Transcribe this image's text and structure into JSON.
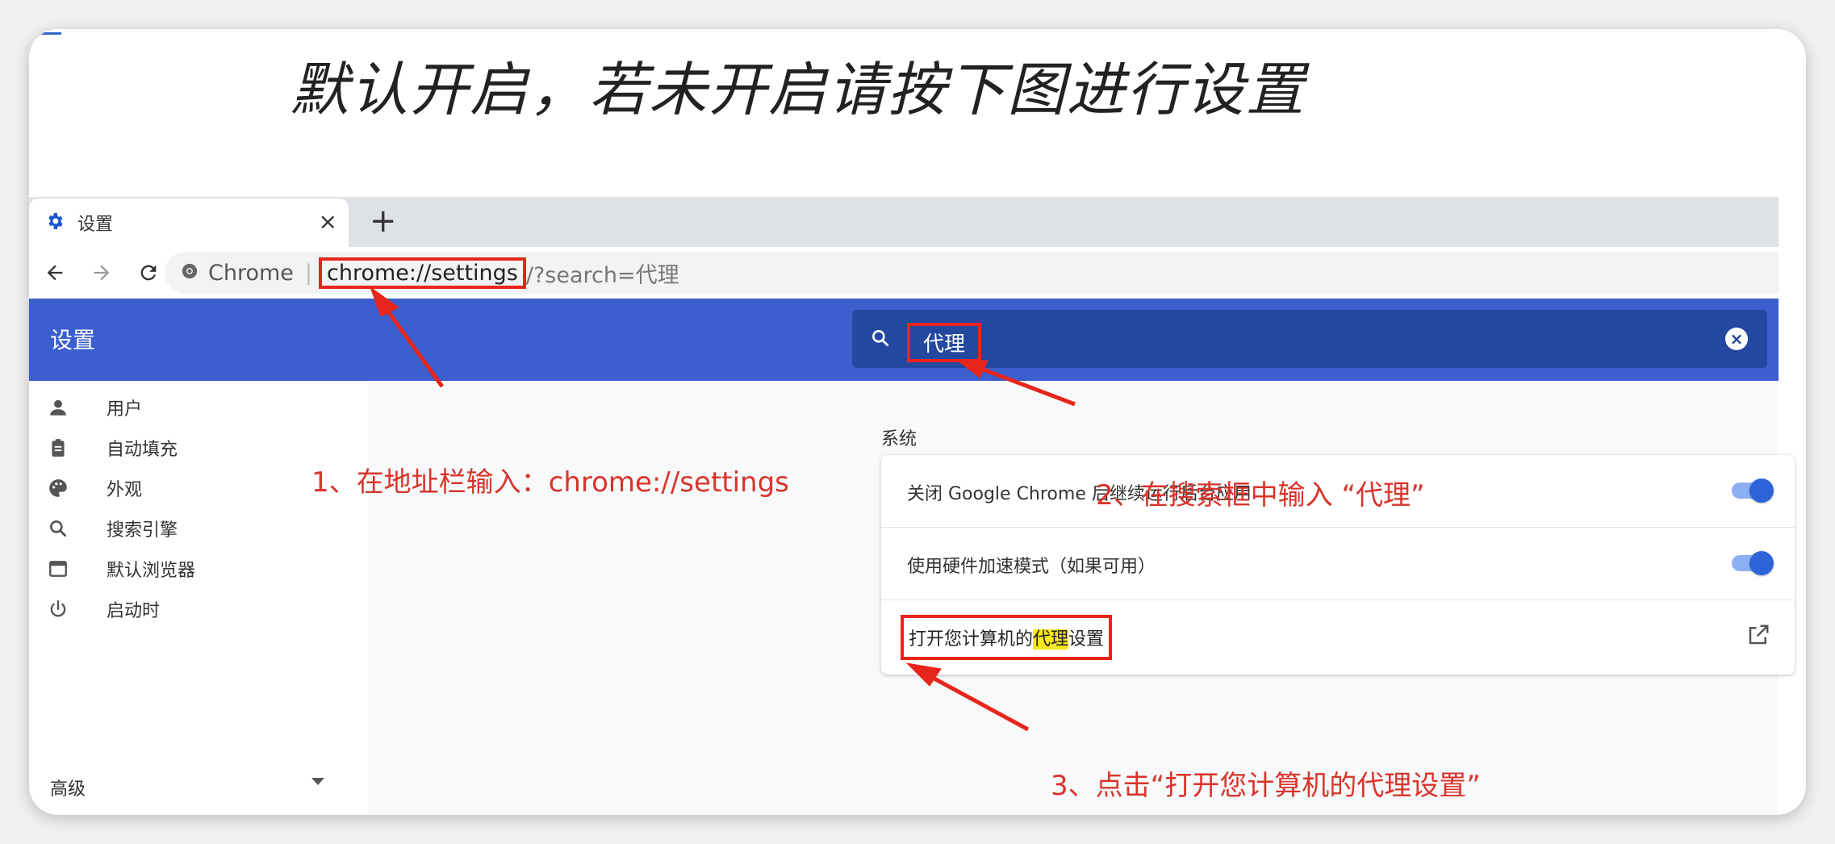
{
  "headline": "默认开启，若未开启请按下图进行设置",
  "tab": {
    "title": "设置",
    "close": "×",
    "new_tab": "+"
  },
  "toolbar": {
    "chip": "Chrome",
    "separator": "|",
    "url": "chrome://settings",
    "query": "/?search=代理"
  },
  "settings": {
    "title": "设置",
    "search": {
      "value": "代理"
    }
  },
  "sidebar": {
    "items": [
      {
        "label": "用户",
        "icon": "person-icon"
      },
      {
        "label": "自动填充",
        "icon": "clipboard-icon"
      },
      {
        "label": "外观",
        "icon": "palette-icon"
      },
      {
        "label": "搜索引擎",
        "icon": "search-icon"
      },
      {
        "label": "默认浏览器",
        "icon": "browser-window-icon"
      },
      {
        "label": "启动时",
        "icon": "power-icon"
      }
    ],
    "advanced": "高级"
  },
  "content": {
    "section": "系统",
    "rows": [
      {
        "label": "关闭 Google Chrome 后继续运行后台应用",
        "toggle": "on"
      },
      {
        "label": "使用硬件加速模式（如果可用）",
        "toggle": "on"
      }
    ],
    "proxy": {
      "prefix": "打开您计算机的",
      "highlight": "代理",
      "suffix": "设置"
    }
  },
  "annotations": {
    "step1": "1、在地址栏输入：chrome://settings",
    "step2": "2、在搜索框中输入 “代理”",
    "step3": "3、点击“打开您计算机的代理设置”"
  },
  "colors": {
    "accent_blue": "#3b5fcf",
    "search_blue": "#24489f",
    "annotation_red": "#e8251c",
    "highlight": "#f8e71c"
  }
}
